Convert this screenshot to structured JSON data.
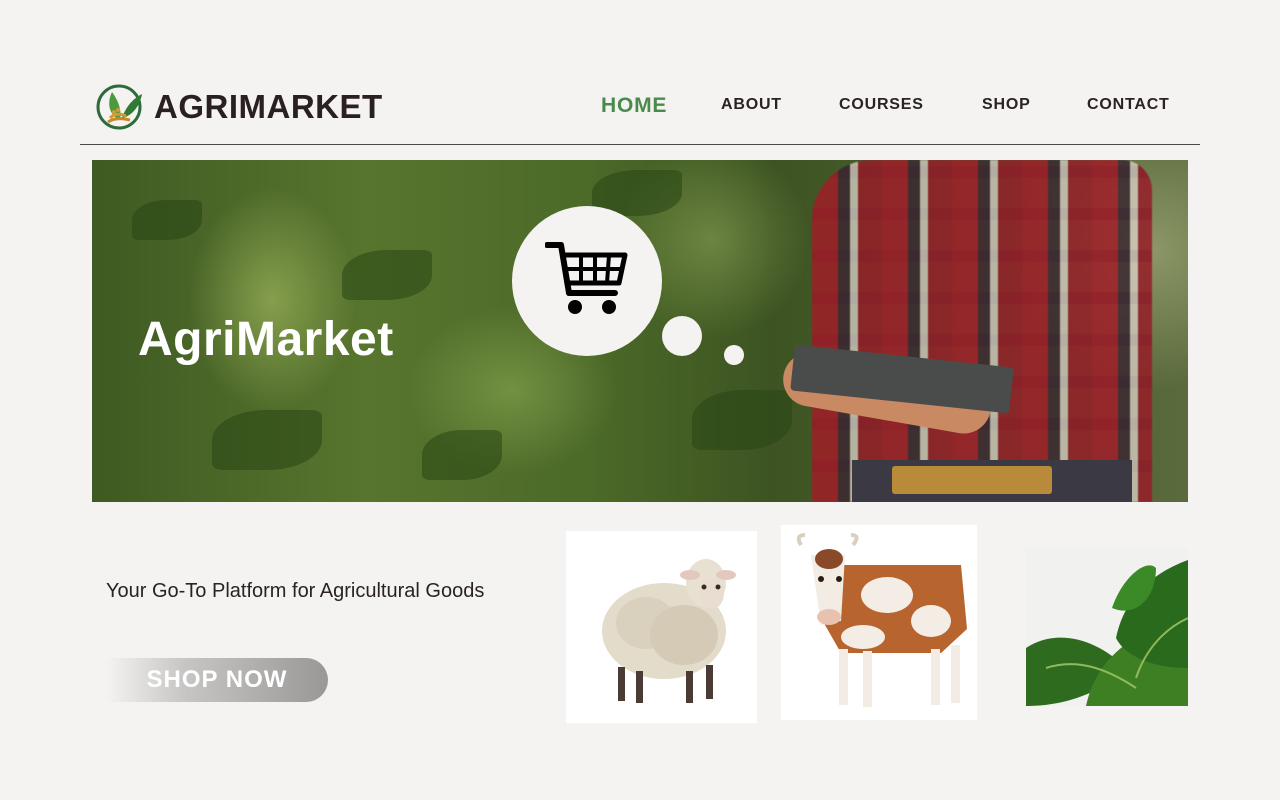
{
  "header": {
    "brand": "AGRIMARKET",
    "logo_icon": "leaf-wheat-logo"
  },
  "nav": {
    "items": [
      {
        "label": "HOME",
        "active": true
      },
      {
        "label": "ABOUT",
        "active": false
      },
      {
        "label": "COURSES",
        "active": false
      },
      {
        "label": "SHOP",
        "active": false
      },
      {
        "label": "CONTACT",
        "active": false
      }
    ]
  },
  "hero": {
    "title": "AgriMarket",
    "icon": "shopping-cart-icon"
  },
  "main": {
    "tagline": "Your Go-To Platform for Agricultural Goods",
    "cta_label": "SHOP NOW"
  },
  "products": [
    {
      "name": "sheep"
    },
    {
      "name": "cow"
    },
    {
      "name": "spinach"
    }
  ],
  "colors": {
    "accent": "#4a8a4c",
    "background": "#f4f3f1",
    "text": "#2b2222"
  }
}
